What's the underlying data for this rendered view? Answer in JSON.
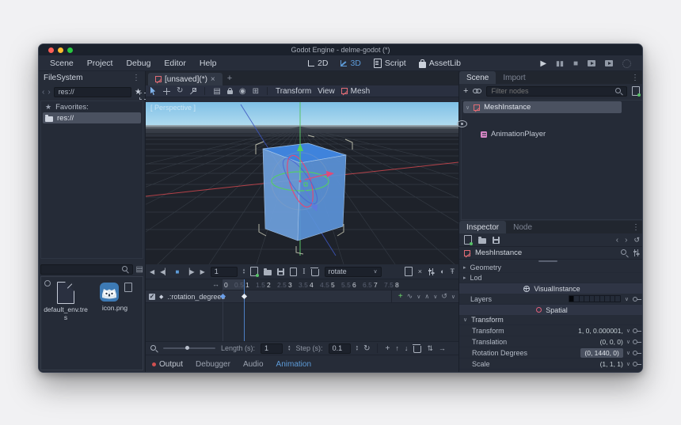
{
  "window": {
    "title": "Godot Engine - delme-godot (*)"
  },
  "menubar": {
    "items": [
      "Scene",
      "Project",
      "Debug",
      "Editor",
      "Help"
    ],
    "workspaces": [
      "2D",
      "3D",
      "Script",
      "AssetLib"
    ]
  },
  "filesystem": {
    "title": "FileSystem",
    "path": "res://",
    "favorites_label": "Favorites:",
    "root_folder": "res://",
    "files": [
      {
        "name": "default_env.tres"
      },
      {
        "name": "icon.png"
      }
    ]
  },
  "main": {
    "scene_tab": "[unsaved](*)",
    "viewport_menus": {
      "transform": "Transform",
      "view": "View",
      "mesh": "Mesh"
    },
    "perspective_label": "[ Perspective ]"
  },
  "animation": {
    "time": "1",
    "name": "rotate",
    "ruler": [
      "0",
      "0.5",
      "1",
      "1.5",
      "2",
      "2.5",
      "3",
      "3.5",
      "4",
      "4.5",
      "5",
      "5.5",
      "6",
      "6.5",
      "7",
      "7.5",
      "8"
    ],
    "track_name": ".:rotation_degrees",
    "length_label": "Length (s):",
    "length_value": "1",
    "step_label": "Step (s):",
    "step_value": "0.1"
  },
  "bottom_tabs": {
    "output": "Output",
    "debugger": "Debugger",
    "audio": "Audio",
    "animation": "Animation"
  },
  "scene_dock": {
    "tabs": {
      "scene": "Scene",
      "import": "Import"
    },
    "filter_placeholder": "Filter nodes",
    "nodes": [
      {
        "name": "MeshInstance"
      },
      {
        "name": "AnimationPlayer"
      }
    ]
  },
  "inspector": {
    "tabs": {
      "inspector": "Inspector",
      "node": "Node"
    },
    "object_name": "MeshInstance",
    "sections": {
      "geometry": "Geometry",
      "lod": "Lod",
      "transform": "Transform"
    },
    "categories": {
      "visual_instance": "VisualInstance",
      "spatial": "Spatial"
    },
    "properties": {
      "layers_label": "Layers",
      "transform": {
        "label": "Transform",
        "value": "1, 0, 0.000001,"
      },
      "translation": {
        "label": "Translation",
        "value": "(0, 0, 0)"
      },
      "rotation_degrees": {
        "label": "Rotation Degrees",
        "value": "(0, 1440, 0)"
      },
      "scale": {
        "label": "Scale",
        "value": "(1, 1, 1)"
      }
    }
  },
  "colors": {
    "accent_blue": "#699ce8",
    "selection_gray": "#4a5160",
    "animation_tab_blue": "#5d9bd8",
    "sky_blue": "#8ac6e6",
    "cube_blue": "#4a8bd8",
    "godot_red": "#e06c75",
    "spatial_red": "#e0607a",
    "output_dot_red": "#d05050",
    "traffic_red": "#ff5f57",
    "traffic_yellow": "#febc2e",
    "traffic_green": "#28c840"
  }
}
